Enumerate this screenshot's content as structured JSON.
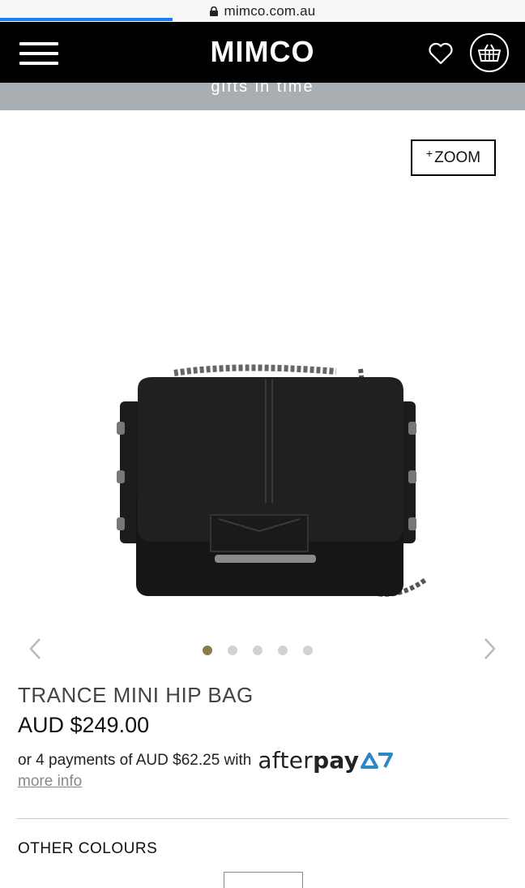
{
  "browser": {
    "url": "mimco.com.au"
  },
  "header": {
    "logo": "MIMCO",
    "tagline": "gifts in time"
  },
  "gallery": {
    "zoom_plus": "+",
    "zoom_label": "ZOOM",
    "dots_total": 5,
    "active_dot": 0
  },
  "product": {
    "name": "TRANCE MINI HIP BAG",
    "price": "AUD $249.00",
    "installment_text": "or 4 payments of AUD $62.25 with",
    "afterpay_after": "after",
    "afterpay_pay": "pay",
    "more_info": "more info"
  },
  "sections": {
    "other_colours": "OTHER COLOURS"
  },
  "colors": {
    "header_bg": "#000000",
    "banner_bg": "#a8aeb2",
    "loading_bar": "#1b7df5",
    "active_dot": "#8c7a50",
    "afterpay_mark": "#2b86c5"
  }
}
